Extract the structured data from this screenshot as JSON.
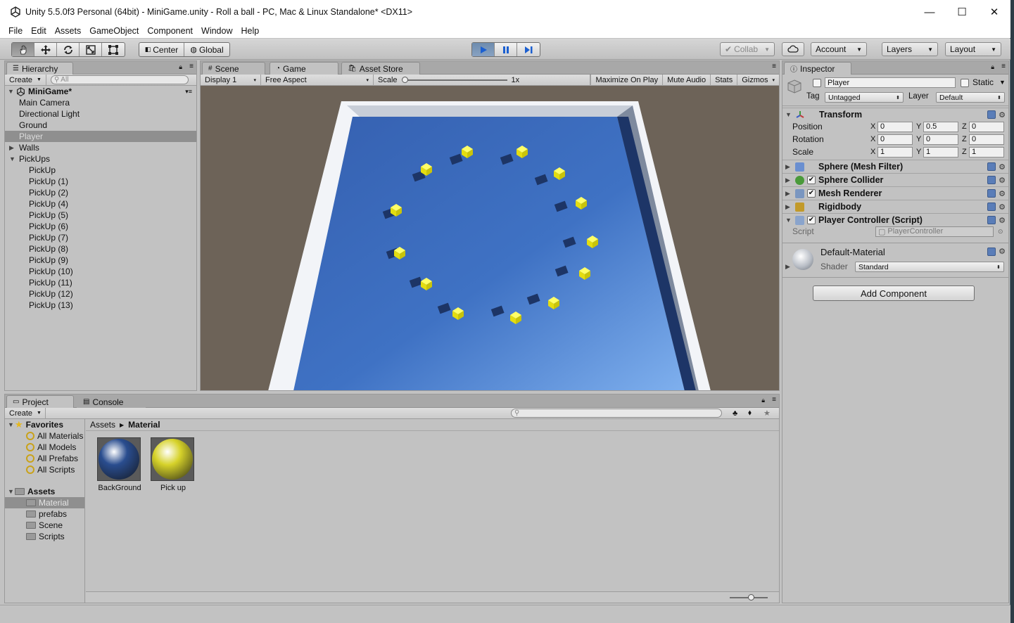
{
  "window": {
    "title": "Unity 5.5.0f3 Personal (64bit) - MiniGame.unity - Roll a ball - PC, Mac & Linux Standalone* <DX11>",
    "minimize": "—",
    "maximize": "☐",
    "close": "✕"
  },
  "menu": [
    "File",
    "Edit",
    "Assets",
    "GameObject",
    "Component",
    "Window",
    "Help"
  ],
  "toolbar": {
    "pivot": "Center",
    "space": "Global",
    "collab": "Collab",
    "account": "Account",
    "layers": "Layers",
    "layout": "Layout"
  },
  "hierarchy": {
    "tab": "Hierarchy",
    "create": "Create",
    "search_placeholder": "All",
    "scene": "MiniGame*",
    "items": [
      {
        "label": "Main Camera",
        "indent": 1,
        "fold": ""
      },
      {
        "label": "Directional Light",
        "indent": 1,
        "fold": ""
      },
      {
        "label": "Ground",
        "indent": 1,
        "fold": ""
      },
      {
        "label": "Player",
        "indent": 1,
        "fold": "",
        "selected": true
      },
      {
        "label": "Walls",
        "indent": 1,
        "fold": "▶"
      },
      {
        "label": "PickUps",
        "indent": 1,
        "fold": "▼"
      },
      {
        "label": "PickUp",
        "indent": 2,
        "fold": ""
      },
      {
        "label": "PickUp (1)",
        "indent": 2,
        "fold": ""
      },
      {
        "label": "PickUp (2)",
        "indent": 2,
        "fold": ""
      },
      {
        "label": "PickUp (4)",
        "indent": 2,
        "fold": ""
      },
      {
        "label": "PickUp (5)",
        "indent": 2,
        "fold": ""
      },
      {
        "label": "PickUp (6)",
        "indent": 2,
        "fold": ""
      },
      {
        "label": "PickUp (7)",
        "indent": 2,
        "fold": ""
      },
      {
        "label": "PickUp (8)",
        "indent": 2,
        "fold": ""
      },
      {
        "label": "PickUp (9)",
        "indent": 2,
        "fold": ""
      },
      {
        "label": "PickUp (10)",
        "indent": 2,
        "fold": ""
      },
      {
        "label": "PickUp (11)",
        "indent": 2,
        "fold": ""
      },
      {
        "label": "PickUp (12)",
        "indent": 2,
        "fold": ""
      },
      {
        "label": "PickUp (13)",
        "indent": 2,
        "fold": ""
      }
    ]
  },
  "center_tabs": {
    "scene": "Scene",
    "game": "Game",
    "asset_store": "Asset Store"
  },
  "game_toolbar": {
    "display": "Display 1",
    "aspect": "Free Aspect",
    "scale_label": "Scale",
    "scale_value": "1x",
    "maximize": "Maximize On Play",
    "mute": "Mute Audio",
    "stats": "Stats",
    "gizmos": "Gizmos"
  },
  "inspector": {
    "tab": "Inspector",
    "object_name": "Player",
    "static_label": "Static",
    "tag_label": "Tag",
    "tag_value": "Untagged",
    "layer_label": "Layer",
    "layer_value": "Default",
    "transform": {
      "title": "Transform",
      "position_label": "Position",
      "rotation_label": "Rotation",
      "scale_label": "Scale",
      "axis_x": "X",
      "axis_y": "Y",
      "axis_z": "Z",
      "position": [
        "0",
        "0.5",
        "0"
      ],
      "rotation": [
        "0",
        "0",
        "0"
      ],
      "scale": [
        "1",
        "1",
        "1"
      ]
    },
    "components": [
      {
        "title": "Sphere (Mesh Filter)",
        "checkbox": false
      },
      {
        "title": "Sphere Collider",
        "checkbox": true
      },
      {
        "title": "Mesh Renderer",
        "checkbox": true
      },
      {
        "title": "Rigidbody",
        "checkbox": false
      },
      {
        "title": "Player Controller (Script)",
        "checkbox": true
      }
    ],
    "script_label": "Script",
    "script_value": "PlayerController",
    "material_name": "Default-Material",
    "shader_label": "Shader",
    "shader_value": "Standard",
    "add_component": "Add Component"
  },
  "project": {
    "tab": "Project",
    "console_tab": "Console",
    "create": "Create",
    "favorites_label": "Favorites",
    "favorites": [
      "All Materials",
      "All Models",
      "All Prefabs",
      "All Scripts"
    ],
    "assets_label": "Assets",
    "folders": [
      "Material",
      "prefabs",
      "Scene",
      "Scripts"
    ],
    "breadcrumb_root": "Assets",
    "breadcrumb_current": "Material",
    "assets": [
      {
        "name": "BackGround",
        "color": "#2a4d8f"
      },
      {
        "name": "Pick up",
        "color": "#d6d22a"
      }
    ]
  },
  "colors": {
    "ground_blue": "#3a6bb8",
    "pickup_yellow": "#f2ee1a",
    "background_brown": "#6d6358"
  }
}
